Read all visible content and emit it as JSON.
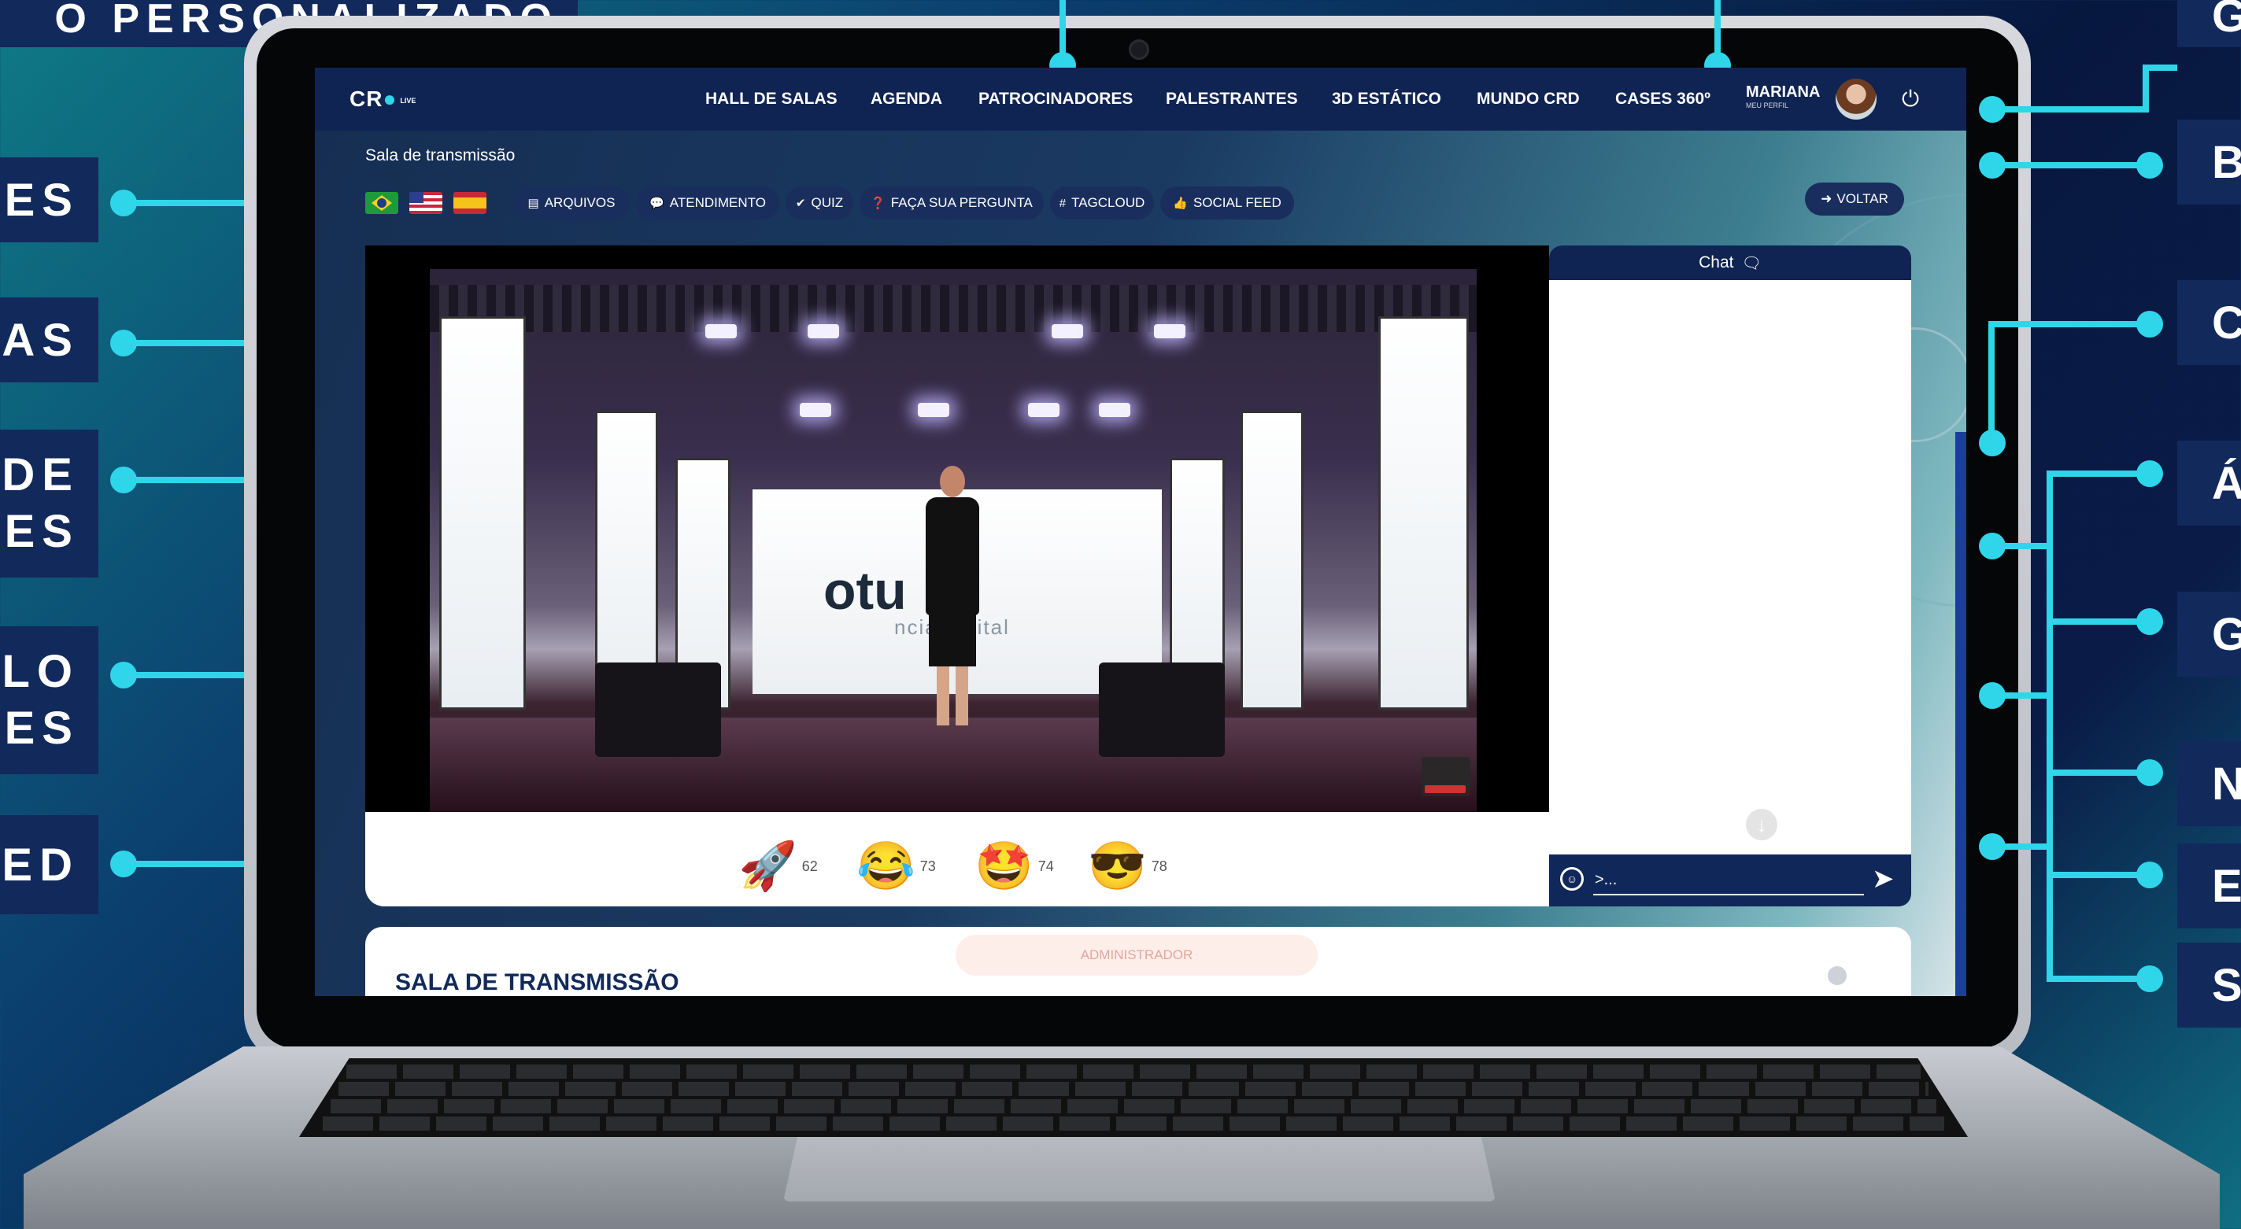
{
  "callouts_left": [
    {
      "text": "O PERSONALIZADO"
    },
    {
      "text": "ES"
    },
    {
      "text": "AS"
    },
    {
      "line1": "DE",
      "line2": "ES"
    },
    {
      "line1": "LO",
      "line2": "ES"
    },
    {
      "text": "ED"
    }
  ],
  "callouts_right": [
    "G",
    "B",
    "C",
    "Á",
    "G",
    "N",
    "E",
    "S"
  ],
  "topbar": {
    "logo": "CR",
    "logo_small": "LIVE",
    "nav": [
      "HALL DE SALAS",
      "AGENDA",
      "PATROCINADORES",
      "PALESTRANTES",
      "3D ESTÁTICO",
      "MUNDO CRD",
      "CASES 360º"
    ],
    "user_name": "MARIANA",
    "user_sub": "MEU PERFIL"
  },
  "room_label": "Sala de transmissão",
  "toolbar": [
    "ARQUIVOS",
    "ATENDIMENTO",
    "QUIZ",
    "FAÇA SUA PERGUNTA",
    "TAGCLOUD",
    "SOCIAL FEED"
  ],
  "voltar": "VOLTAR",
  "video": {
    "brand": "otu",
    "brand_sub": "ncia digital"
  },
  "reactions": [
    {
      "emoji": "🚀",
      "count": "62"
    },
    {
      "emoji": "😂",
      "count": "73"
    },
    {
      "emoji": "🤩",
      "count": "74"
    },
    {
      "emoji": "😎",
      "count": "78"
    }
  ],
  "chat": {
    "title": "Chat",
    "placeholder": ">..."
  },
  "info": {
    "title": "SALA DE TRANSMISSÃO",
    "admin": "ADMINISTRADOR"
  },
  "colors": {
    "accent": "#2fd6ea",
    "navy": "#0f2452",
    "callout_bg": "#12295c"
  }
}
